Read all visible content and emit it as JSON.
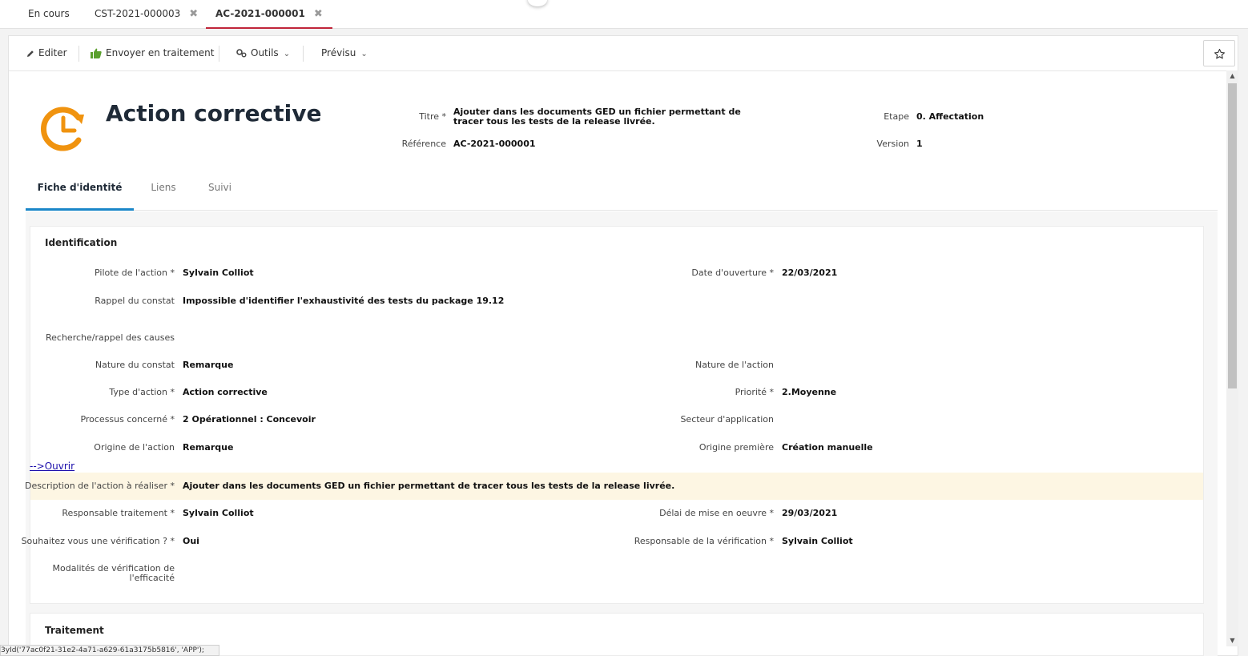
{
  "tabs": [
    {
      "label": "En cours",
      "closable": false,
      "active": false
    },
    {
      "label": "CST-2021-000003",
      "closable": true,
      "active": false
    },
    {
      "label": "AC-2021-000001",
      "closable": true,
      "active": true
    }
  ],
  "close_glyph": "✖",
  "toolbar": {
    "edit_label": "Editer",
    "send_label": "Envoyer en traitement",
    "tools_label": "Outils",
    "preview_label": "Prévisu"
  },
  "header": {
    "title": "Action corrective",
    "fields": {
      "titre_label": "Titre *",
      "titre_value": "Ajouter dans les documents GED un fichier permettant de tracer tous les tests de la release livrée.",
      "reference_label": "Référence",
      "reference_value": "AC-2021-000001",
      "etape_label": "Etape",
      "etape_value": "0. Affectation",
      "version_label": "Version",
      "version_value": "1"
    }
  },
  "sub_tabs": [
    "Fiche d'identité",
    "Liens",
    "Suivi"
  ],
  "identification": {
    "title": "Identification",
    "pilote_label": "Pilote de l'action *",
    "pilote_value": "Sylvain Colliot",
    "date_ouverture_label": "Date d'ouverture *",
    "date_ouverture_value": "22/03/2021",
    "rappel_label": "Rappel du constat",
    "rappel_value": "Impossible d'identifier l'exhaustivité des tests du package 19.12",
    "recherche_label": "Recherche/rappel des causes",
    "nature_constat_label": "Nature du constat",
    "nature_constat_value": "Remarque",
    "nature_action_label": "Nature de l'action",
    "type_action_label": "Type d'action *",
    "type_action_value": "Action corrective",
    "priorite_label": "Priorité *",
    "priorite_value": "2.Moyenne",
    "processus_label": "Processus concerné *",
    "processus_value": "2 Opérationnel : Concevoir",
    "secteur_label": "Secteur d'application",
    "origine_label": "Origine de l'action",
    "origine_value": "Remarque",
    "origine_premiere_label": "Origine première",
    "origine_premiere_value": "Création manuelle",
    "open_link": "-->Ouvrir",
    "description_label": "Description de l'action à réaliser *",
    "description_value": "Ajouter dans les documents GED un fichier permettant de tracer tous les tests de la release livrée.",
    "resp_traitement_label": "Responsable traitement *",
    "resp_traitement_value": "Sylvain Colliot",
    "delai_label": "Délai de mise en oeuvre *",
    "delai_value": "29/03/2021",
    "verification_label": "Souhaitez vous une vérification ? *",
    "verification_value": "Oui",
    "resp_verification_label": "Responsable de la vérification *",
    "resp_verification_value": "Sylvain Colliot",
    "modalites_label_line1": "Modalités de vérification de",
    "modalites_label_line2": "l'efficacité"
  },
  "traitement": {
    "title": "Traitement"
  },
  "status_bar": "3yId('77ac0f21-31e2-4a71-a629-61a3175b5816', 'APP');",
  "colors": {
    "active_tab_underline": "#c0263a",
    "sub_tab_underline": "#1a86c8",
    "icon_orange": "#f0930f",
    "highlight_row": "#fdf6e3",
    "thumbs_green": "#5aa02c"
  },
  "icons": [
    "pencil-icon",
    "thumbs-up-icon",
    "gears-icon",
    "chevron-down-icon",
    "star-icon",
    "clock-arrow-icon",
    "close-icon"
  ]
}
